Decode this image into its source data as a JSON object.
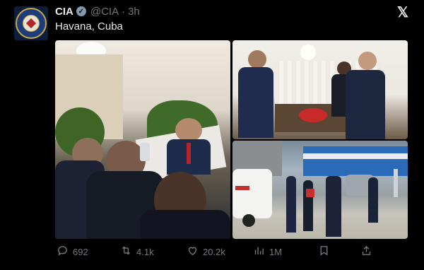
{
  "tweet": {
    "name": "CIA",
    "handle": "@CIA",
    "separator": "·",
    "time": "3h",
    "text": "Havana, Cuba"
  },
  "images": {
    "count": 3
  },
  "actions": {
    "replies": "692",
    "retweets": "4.1k",
    "likes": "20.2k",
    "views": "1M"
  },
  "icons": {
    "close": "x-logo-icon",
    "reply": "reply-icon",
    "retweet": "retweet-icon",
    "like": "heart-icon",
    "views": "views-chart-icon",
    "bookmark": "bookmark-icon",
    "share": "share-icon",
    "verified": "verified-badge-icon"
  },
  "colors": {
    "background": "#000000",
    "text": "#e7e9ea",
    "muted": "#71767b",
    "verified_badge": "#829aab"
  }
}
